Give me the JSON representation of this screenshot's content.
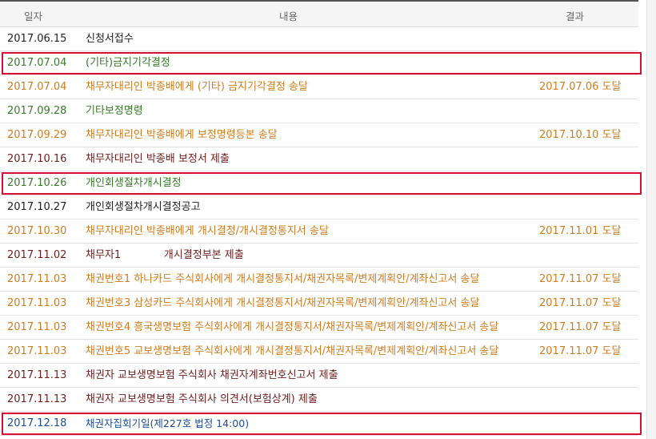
{
  "header": {
    "date": "일자",
    "content": "내용",
    "result": "결과"
  },
  "colors": {
    "black": "#222222",
    "green": "#3b7a2c",
    "orange": "#cf7d22",
    "maroon": "#6e1f1f",
    "blue": "#1d4c9a",
    "highlight": "#d80f35"
  },
  "rows": [
    {
      "date": "2017.06.15",
      "content": "신청서접수",
      "result": "",
      "tone": "black"
    },
    {
      "date": "2017.07.04",
      "content": "(기타)금지기각결정",
      "result": "",
      "tone": "green",
      "highlighted": true
    },
    {
      "date": "2017.07.04",
      "content": "채무자대리인 박종배에게 (기타) 금지기각결정 송달",
      "result": "2017.07.06 도달",
      "tone": "orange"
    },
    {
      "date": "2017.09.28",
      "content": "기타보정명령",
      "result": "",
      "tone": "green"
    },
    {
      "date": "2017.09.29",
      "content": "채무자대리인 박종배에게 보정명령등본 송달",
      "result": "2017.10.10 도달",
      "tone": "orange"
    },
    {
      "date": "2017.10.16",
      "content": "채무자대리인 박종배 보정서 제출",
      "result": "",
      "tone": "maroon"
    },
    {
      "date": "2017.10.26",
      "content": "개인회생절차개시결정",
      "result": "",
      "tone": "green",
      "highlighted": true
    },
    {
      "date": "2017.10.27",
      "content": "개인회생절차개시결정공고",
      "result": "",
      "tone": "black"
    },
    {
      "date": "2017.10.30",
      "content": "채무자대리인 박종배에게 개시결정/개시결정통지서 송달",
      "result": "2017.11.01 도달",
      "tone": "orange"
    },
    {
      "date": "2017.11.02",
      "content": "채무자1             개시결정부본 제출",
      "result": "",
      "tone": "maroon"
    },
    {
      "date": "2017.11.03",
      "content": "채권번호1 하나카드 주식회사에게 개시결정통지서/채권자목록/변제계획안/계좌신고서 송달",
      "result": "2017.11.07 도달",
      "tone": "orange"
    },
    {
      "date": "2017.11.03",
      "content": "채권번호3 삼성카드 주식회사에게 개시결정통지서/채권자목록/변제계획안/계좌신고서 송달",
      "result": "2017.11.07 도달",
      "tone": "orange"
    },
    {
      "date": "2017.11.03",
      "content": "채권번호4 흥국생명보험 주식회사에게 개시결정통지서/채권자목록/변제계획안/계좌신고서 송달",
      "result": "2017.11.07 도달",
      "tone": "orange"
    },
    {
      "date": "2017.11.03",
      "content": "채권번호5 교보생명보험 주식회사에게 개시결정통지서/채권자목록/변제계획안/계좌신고서 송달",
      "result": "2017.11.07 도달",
      "tone": "orange"
    },
    {
      "date": "2017.11.13",
      "content": "채권자 교보생명보험 주식회사 채권자계좌번호신고서 제출",
      "result": "",
      "tone": "maroon"
    },
    {
      "date": "2017.11.13",
      "content": "채권자 교보생명보험 주식회사 의견서(보험상계) 제출",
      "result": "",
      "tone": "maroon"
    },
    {
      "date": "2017.12.18",
      "content": "채권자집회기일(제227호 법정 14:00)",
      "result": "",
      "tone": "blue",
      "highlighted": true
    }
  ]
}
